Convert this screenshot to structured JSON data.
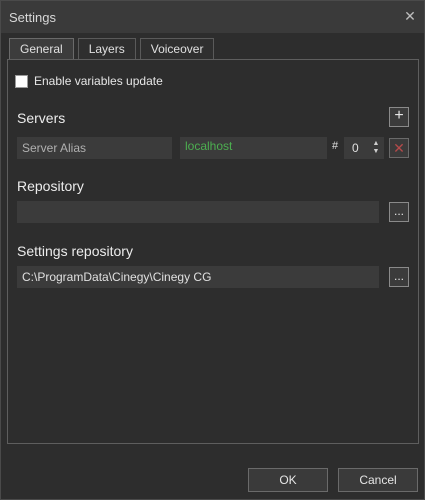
{
  "window": {
    "title": "Settings",
    "close_glyph": "✕"
  },
  "tabs": [
    {
      "label": "General",
      "active": true
    },
    {
      "label": "Layers",
      "active": false
    },
    {
      "label": "Voiceover",
      "active": false
    }
  ],
  "general": {
    "enable_variables_update": {
      "label": "Enable variables update",
      "checked": false
    },
    "servers": {
      "title": "Servers",
      "add_glyph": "+",
      "alias_placeholder": "Server Alias",
      "host_value": "localhost",
      "hash_label": "#",
      "index_value": "0",
      "delete_glyph": "✕"
    },
    "repository": {
      "title": "Repository",
      "value": "",
      "browse_label": "..."
    },
    "settings_repository": {
      "title": "Settings repository",
      "value": "C:\\ProgramData\\Cinegy\\Cinegy CG",
      "browse_label": "..."
    }
  },
  "footer": {
    "ok_label": "OK",
    "cancel_label": "Cancel"
  },
  "colors": {
    "accent_green": "#4caf50",
    "delete_red": "#b44a4a",
    "background": "#2d2d2d"
  }
}
